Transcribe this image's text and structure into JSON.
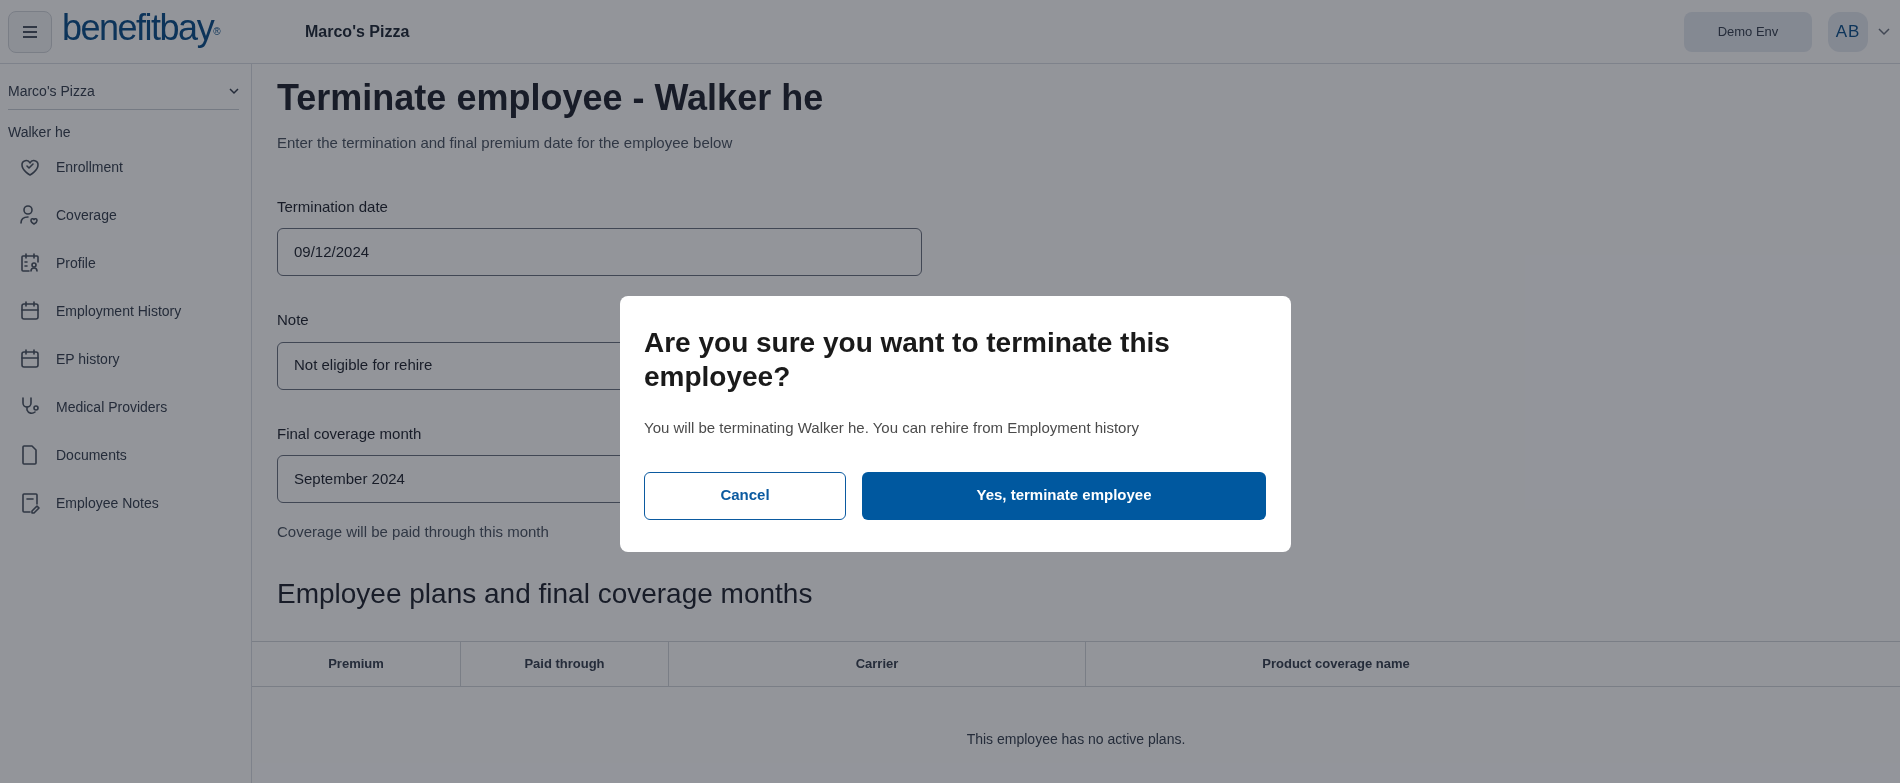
{
  "header": {
    "logo": "benefitbay",
    "logo_mark": "®",
    "company": "Marco's Pizza",
    "env_button": "Demo Env",
    "avatar": "AB"
  },
  "sidebar": {
    "company_select": "Marco's Pizza",
    "employee": "Walker he",
    "items": [
      {
        "label": "Enrollment"
      },
      {
        "label": "Coverage"
      },
      {
        "label": "Profile"
      },
      {
        "label": "Employment History"
      },
      {
        "label": "EP history"
      },
      {
        "label": "Medical Providers"
      },
      {
        "label": "Documents"
      },
      {
        "label": "Employee Notes"
      }
    ]
  },
  "page": {
    "title": "Terminate employee - Walker he",
    "subtitle": "Enter the termination and final premium date for the employee below",
    "fields": [
      {
        "label": "Termination date",
        "value": "09/12/2024"
      },
      {
        "label": "Note",
        "value": "Not eligible for rehire"
      },
      {
        "label": "Final coverage month",
        "value": "September 2024",
        "helper": "Coverage will be paid through this month"
      }
    ],
    "section_title": "Employee plans and final coverage months",
    "table": {
      "columns": [
        "Premium",
        "Paid through",
        "Carrier",
        "Product coverage name"
      ],
      "empty_message": "This employee has no active plans."
    }
  },
  "dialog": {
    "title": "Are you sure you want to terminate this employee?",
    "message": "You will be terminating Walker he. You can rehire from Employment history",
    "buttons": [
      {
        "label": "Cancel",
        "kind": "secondary"
      },
      {
        "label": "Yes, terminate employee",
        "kind": "primary"
      }
    ]
  }
}
